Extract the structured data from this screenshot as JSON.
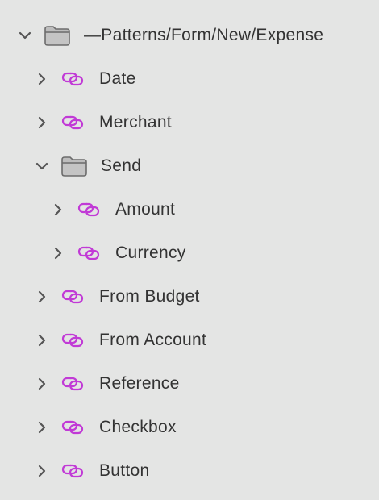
{
  "tree": {
    "root": {
      "label": "—Patterns/Form/New/Expense",
      "expanded": true,
      "icon": "folder-icon"
    },
    "items": [
      {
        "label": "Date",
        "icon": "link-icon",
        "expanded": false
      },
      {
        "label": "Merchant",
        "icon": "link-icon",
        "expanded": false
      },
      {
        "label": "Send",
        "icon": "folder-icon",
        "expanded": true,
        "children": [
          {
            "label": "Amount",
            "icon": "link-icon",
            "expanded": false
          },
          {
            "label": "Currency",
            "icon": "link-icon",
            "expanded": false
          }
        ]
      },
      {
        "label": "From Budget",
        "icon": "link-icon",
        "expanded": false
      },
      {
        "label": "From Account",
        "icon": "link-icon",
        "expanded": false
      },
      {
        "label": "Reference",
        "icon": "link-icon",
        "expanded": false
      },
      {
        "label": "Checkbox",
        "icon": "link-icon",
        "expanded": false
      },
      {
        "label": "Button",
        "icon": "link-icon",
        "expanded": false
      }
    ]
  },
  "colors": {
    "background": "#e4e5e4",
    "text": "#333333",
    "chevron": "#555555",
    "link_icon": "#c13ad6",
    "folder_fill": "#b9b9b9",
    "folder_stroke": "#6c6c6c"
  }
}
